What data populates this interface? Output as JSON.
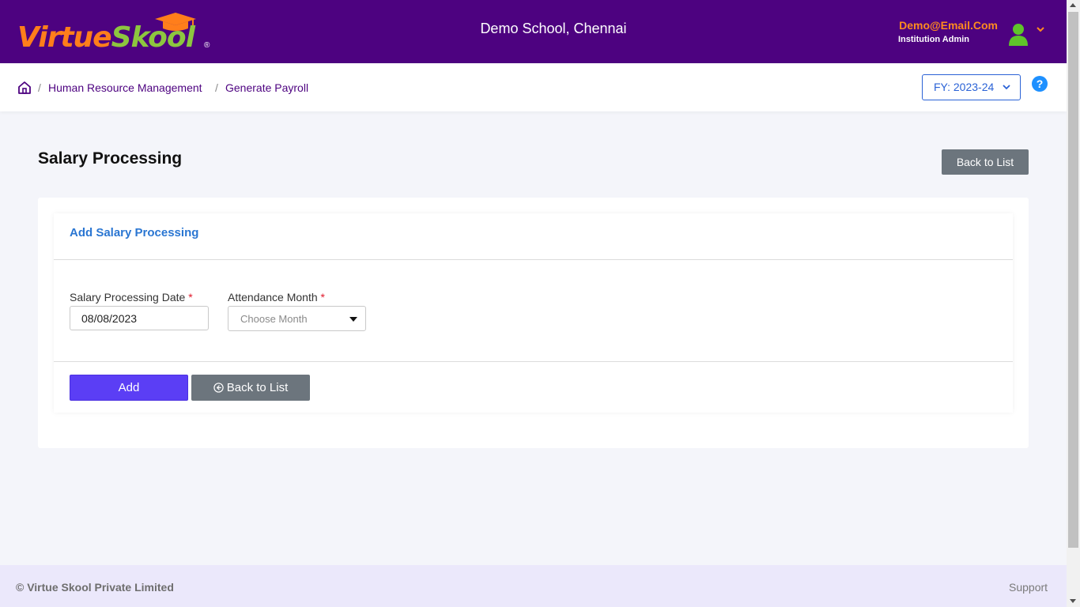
{
  "header": {
    "logo": {
      "part1": "Virtue",
      "part2": "Skool",
      "reg": "®"
    },
    "school_name": "Demo School, Chennai",
    "user_email": "Demo@Email.Com",
    "user_role": "Institution Admin",
    "avatar_icon": "user-avatar-icon",
    "menu_icon": "chevron-down-icon"
  },
  "breadcrumb": {
    "home_icon": "home-icon",
    "separator": "/",
    "items": [
      "Human Resource Management",
      "Generate Payroll"
    ],
    "fy_label": "FY: 2023-24",
    "help_label": "?"
  },
  "page": {
    "title": "Salary Processing",
    "back_to_list": "Back to List"
  },
  "form": {
    "card_title": "Add Salary Processing",
    "date_label": "Salary Processing Date",
    "date_value": "08/08/2023",
    "month_label": "Attendance Month",
    "month_placeholder": "Choose Month",
    "required_marker": "*",
    "add_button": "Add",
    "back_button": "Back to List"
  },
  "footer": {
    "copyright": "© Virtue Skool Private Limited",
    "support": "Support"
  },
  "colors": {
    "header_bg": "#4d0280",
    "accent_orange": "#ff7e1b",
    "accent_green": "#8dc63f",
    "primary_button": "#5b3ef5",
    "secondary_button": "#6c757d",
    "link_blue": "#2a76d2"
  }
}
